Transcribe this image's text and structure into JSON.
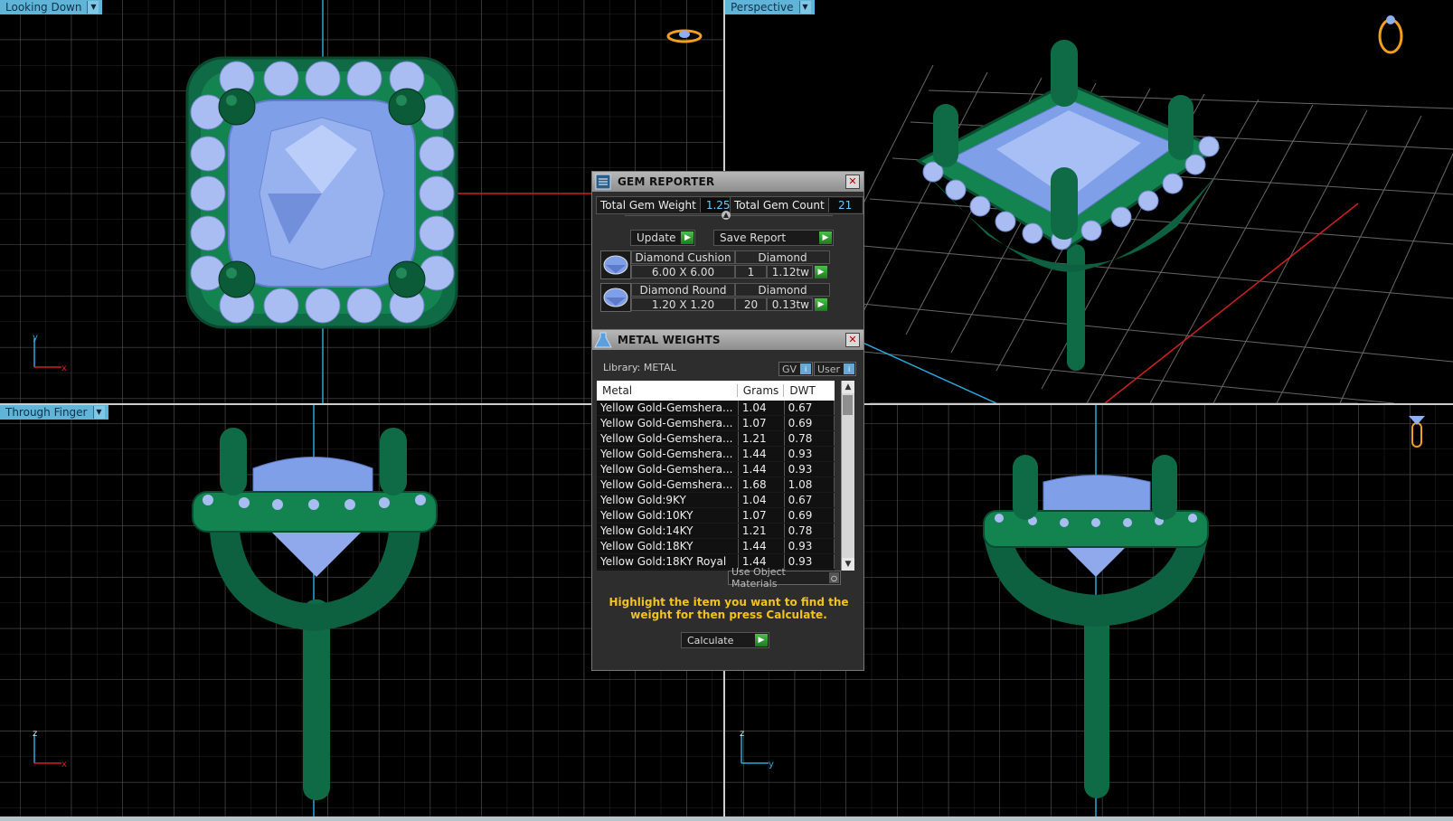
{
  "viewports": {
    "top_left": {
      "label": "Looking Down",
      "axis_a": "y",
      "axis_b": "x"
    },
    "top_right": {
      "label": "Perspective"
    },
    "bottom_left": {
      "label": "Through Finger",
      "axis_a": "z",
      "axis_b": "x"
    },
    "bottom_right": {
      "axis_a": "z",
      "axis_b": "y"
    }
  },
  "gem_reporter": {
    "title": "GEM REPORTER",
    "total_weight_label": "Total Gem Weight",
    "total_weight": "1.25",
    "total_count_label": "Total Gem Count",
    "total_count": "21",
    "update_label": "Update",
    "save_label": "Save Report",
    "gems": [
      {
        "name": "Diamond Cushion",
        "material": "Diamond",
        "size": "6.00 X 6.00",
        "count": "1",
        "weight": "1.12tw"
      },
      {
        "name": "Diamond Round",
        "material": "Diamond",
        "size": "1.20 X 1.20",
        "count": "20",
        "weight": "0.13tw"
      }
    ]
  },
  "metal_weights": {
    "title": "METAL WEIGHTS",
    "library": "Library: METAL",
    "gv_label": "GV",
    "user_label": "User",
    "columns": [
      "Metal",
      "Grams",
      "DWT"
    ],
    "rows": [
      [
        "Yellow Gold-Gemshera...",
        "1.04",
        "0.67"
      ],
      [
        "Yellow Gold-Gemshera...",
        "1.07",
        "0.69"
      ],
      [
        "Yellow Gold-Gemshera...",
        "1.21",
        "0.78"
      ],
      [
        "Yellow Gold-Gemshera...",
        "1.44",
        "0.93"
      ],
      [
        "Yellow Gold-Gemshera...",
        "1.44",
        "0.93"
      ],
      [
        "Yellow Gold-Gemshera...",
        "1.68",
        "1.08"
      ],
      [
        "Yellow Gold:9KY",
        "1.04",
        "0.67"
      ],
      [
        "Yellow Gold:10KY",
        "1.07",
        "0.69"
      ],
      [
        "Yellow Gold:14KY",
        "1.21",
        "0.78"
      ],
      [
        "Yellow Gold:18KY",
        "1.44",
        "0.93"
      ],
      [
        "Yellow Gold:18KY Royal",
        "1.44",
        "0.93"
      ]
    ],
    "use_object_label": "Use Object Materials",
    "instruction": "Highlight the item you want to find the weight for then press Calculate.",
    "calculate_label": "Calculate"
  },
  "colors": {
    "metal": "#0f6b45",
    "gem": "#7f9fe8",
    "grid": "#5a5a5a",
    "label_bg": "#5fb4d8",
    "instruction": "#f2c31a"
  },
  "icons": {
    "ring_top": "ring-icon",
    "ring_persp": "ring-icon",
    "ring_side": "ring-side-icon"
  }
}
